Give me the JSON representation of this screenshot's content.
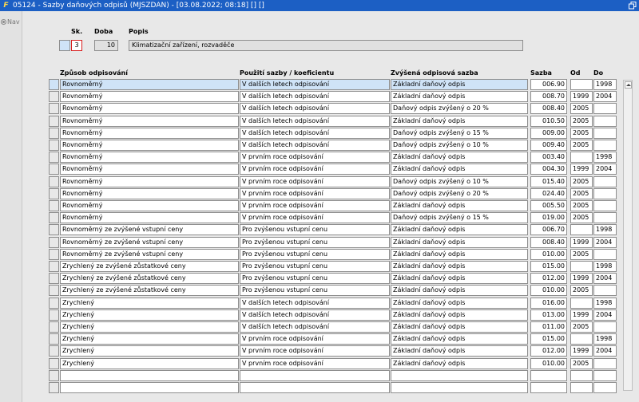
{
  "window": {
    "title": "05124 - Sazby daňových odpisů (MJSZDAN) - [03.08.2022; 08:18] [] []"
  },
  "sidebar": {
    "nav_label": "Nav"
  },
  "header": {
    "sk_label": "Sk.",
    "doba_label": "Doba",
    "popis_label": "Popis",
    "sk_value": "3",
    "doba_value": "10",
    "popis_value": "Klimatizační zařízení, rozvaděče"
  },
  "columns": {
    "zpusob": "Způsob odpisování",
    "pouziti": "Použití sazby / koeficientu",
    "zvysena": "Zvýšená odpisová sazba",
    "sazba": "Sazba",
    "od": "Od",
    "do": "Do"
  },
  "rows": [
    {
      "zpusob": "Rovnoměrný",
      "pouziti": "V dalších letech odpisování",
      "zvysena": "Základní daňový odpis",
      "sazba": "006.90",
      "od": "",
      "do": "1998"
    },
    {
      "zpusob": "Rovnoměrný",
      "pouziti": "V dalších letech odpisování",
      "zvysena": "Základní daňový odpis",
      "sazba": "008.70",
      "od": "1999",
      "do": "2004"
    },
    {
      "zpusob": "Rovnoměrný",
      "pouziti": "V dalších letech odpisování",
      "zvysena": "Daňový odpis zvýšený o 20 %",
      "sazba": "008.40",
      "od": "2005",
      "do": ""
    },
    {
      "zpusob": "Rovnoměrný",
      "pouziti": "V dalších letech odpisování",
      "zvysena": "Základní daňový odpis",
      "sazba": "010.50",
      "od": "2005",
      "do": ""
    },
    {
      "zpusob": "Rovnoměrný",
      "pouziti": "V dalších letech odpisování",
      "zvysena": "Daňový odpis zvýšený o 15 %",
      "sazba": "009.00",
      "od": "2005",
      "do": ""
    },
    {
      "zpusob": "Rovnoměrný",
      "pouziti": "V dalších letech odpisování",
      "zvysena": "Daňový odpis zvýšený o 10 %",
      "sazba": "009.40",
      "od": "2005",
      "do": ""
    },
    {
      "zpusob": "Rovnoměrný",
      "pouziti": "V prvním roce odpisování",
      "zvysena": "Základní daňový odpis",
      "sazba": "003.40",
      "od": "",
      "do": "1998"
    },
    {
      "zpusob": "Rovnoměrný",
      "pouziti": "V prvním roce odpisování",
      "zvysena": "Základní daňový odpis",
      "sazba": "004.30",
      "od": "1999",
      "do": "2004"
    },
    {
      "zpusob": "Rovnoměrný",
      "pouziti": "V prvním roce odpisování",
      "zvysena": "Daňový odpis zvýšený o 10 %",
      "sazba": "015.40",
      "od": "2005",
      "do": ""
    },
    {
      "zpusob": "Rovnoměrný",
      "pouziti": "V prvním roce odpisování",
      "zvysena": "Daňový odpis zvýšený o 20 %",
      "sazba": "024.40",
      "od": "2005",
      "do": ""
    },
    {
      "zpusob": "Rovnoměrný",
      "pouziti": "V prvním roce odpisování",
      "zvysena": "Základní daňový odpis",
      "sazba": "005.50",
      "od": "2005",
      "do": ""
    },
    {
      "zpusob": "Rovnoměrný",
      "pouziti": "V prvním roce odpisování",
      "zvysena": "Daňový odpis zvýšený o 15 %",
      "sazba": "019.00",
      "od": "2005",
      "do": ""
    },
    {
      "zpusob": "Rovnoměrný ze zvýšené vstupní ceny",
      "pouziti": "Pro zvýšenou vstupní cenu",
      "zvysena": "Základní daňový odpis",
      "sazba": "006.70",
      "od": "",
      "do": "1998"
    },
    {
      "zpusob": "Rovnoměrný ze zvýšené vstupní ceny",
      "pouziti": "Pro zvýšenou vstupní cenu",
      "zvysena": "Základní daňový odpis",
      "sazba": "008.40",
      "od": "1999",
      "do": "2004"
    },
    {
      "zpusob": "Rovnoměrný ze zvýšené vstupní ceny",
      "pouziti": "Pro zvýšenou vstupní cenu",
      "zvysena": "Základní daňový odpis",
      "sazba": "010.00",
      "od": "2005",
      "do": ""
    },
    {
      "zpusob": "Zrychlený ze zvýšené zůstatkové ceny",
      "pouziti": "Pro zvýšenou vstupní cenu",
      "zvysena": "Základní daňový odpis",
      "sazba": "015.00",
      "od": "",
      "do": "1998"
    },
    {
      "zpusob": "Zrychlený ze zvýšené zůstatkové ceny",
      "pouziti": "Pro zvýšenou vstupní cenu",
      "zvysena": "Základní daňový odpis",
      "sazba": "012.00",
      "od": "1999",
      "do": "2004"
    },
    {
      "zpusob": "Zrychlený ze zvýšené zůstatkové ceny",
      "pouziti": "Pro zvýšenou vstupní cenu",
      "zvysena": "Základní daňový odpis",
      "sazba": "010.00",
      "od": "2005",
      "do": ""
    },
    {
      "zpusob": "Zrychlený",
      "pouziti": "V dalších letech odpisování",
      "zvysena": "Základní daňový odpis",
      "sazba": "016.00",
      "od": "",
      "do": "1998"
    },
    {
      "zpusob": "Zrychlený",
      "pouziti": "V dalších letech odpisování",
      "zvysena": "Základní daňový odpis",
      "sazba": "013.00",
      "od": "1999",
      "do": "2004"
    },
    {
      "zpusob": "Zrychlený",
      "pouziti": "V dalších letech odpisování",
      "zvysena": "Základní daňový odpis",
      "sazba": "011.00",
      "od": "2005",
      "do": ""
    },
    {
      "zpusob": "Zrychlený",
      "pouziti": "V prvním roce odpisování",
      "zvysena": "Základní daňový odpis",
      "sazba": "015.00",
      "od": "",
      "do": "1998"
    },
    {
      "zpusob": "Zrychlený",
      "pouziti": "V prvním roce odpisování",
      "zvysena": "Základní daňový odpis",
      "sazba": "012.00",
      "od": "1999",
      "do": "2004"
    },
    {
      "zpusob": "Zrychlený",
      "pouziti": "V prvním roce odpisování",
      "zvysena": "Základní daňový odpis",
      "sazba": "010.00",
      "od": "2005",
      "do": ""
    },
    {
      "zpusob": "",
      "pouziti": "",
      "zvysena": "",
      "sazba": "",
      "od": "",
      "do": ""
    },
    {
      "zpusob": "",
      "pouziti": "",
      "zvysena": "",
      "sazba": "",
      "od": "",
      "do": ""
    }
  ]
}
